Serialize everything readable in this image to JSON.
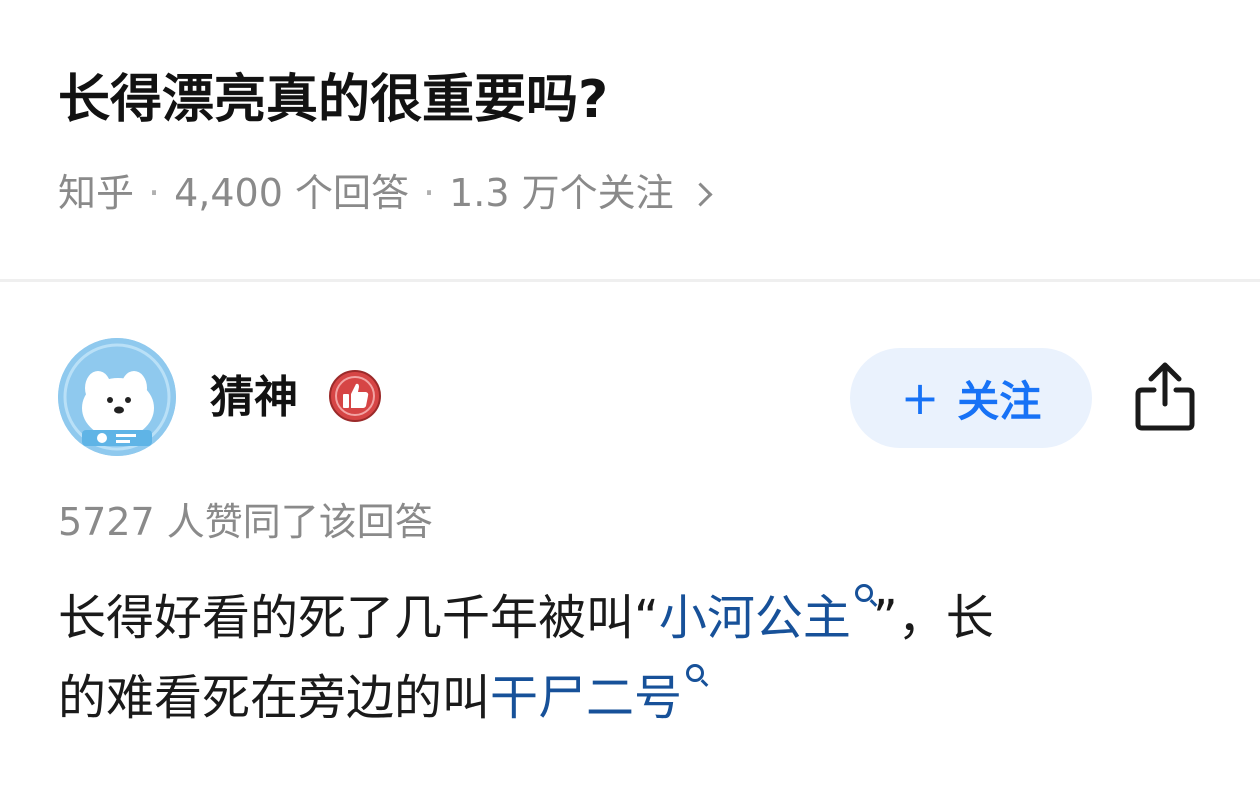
{
  "question": {
    "title": "长得漂亮真的很重要吗?",
    "source": "知乎",
    "answer_count": "4,400 个回答",
    "follower_count": "1.3 万个关注"
  },
  "author": {
    "name": "猜神",
    "follow_label": "关注",
    "follow_plus": "+"
  },
  "answer": {
    "votes": "5727 人赞同了该回答",
    "line1_prefix": "长得好看的死了几千年被叫“",
    "line1_link": "小河公主",
    "line1_suffix": "”，长",
    "line2_prefix": "的难看死在旁边的叫",
    "line2_link": "干尸二号"
  },
  "colors": {
    "link": "#175199",
    "accent": "#1772f6",
    "meta_gray": "#8a8a8a",
    "avatar_bg": "#8fc9ee",
    "badge_red": "#d64545"
  },
  "icons": {
    "meta_more": "chevron-right-icon",
    "badge": "thumbs-up-badge-icon",
    "share": "share-icon",
    "link_search": "search-icon"
  }
}
